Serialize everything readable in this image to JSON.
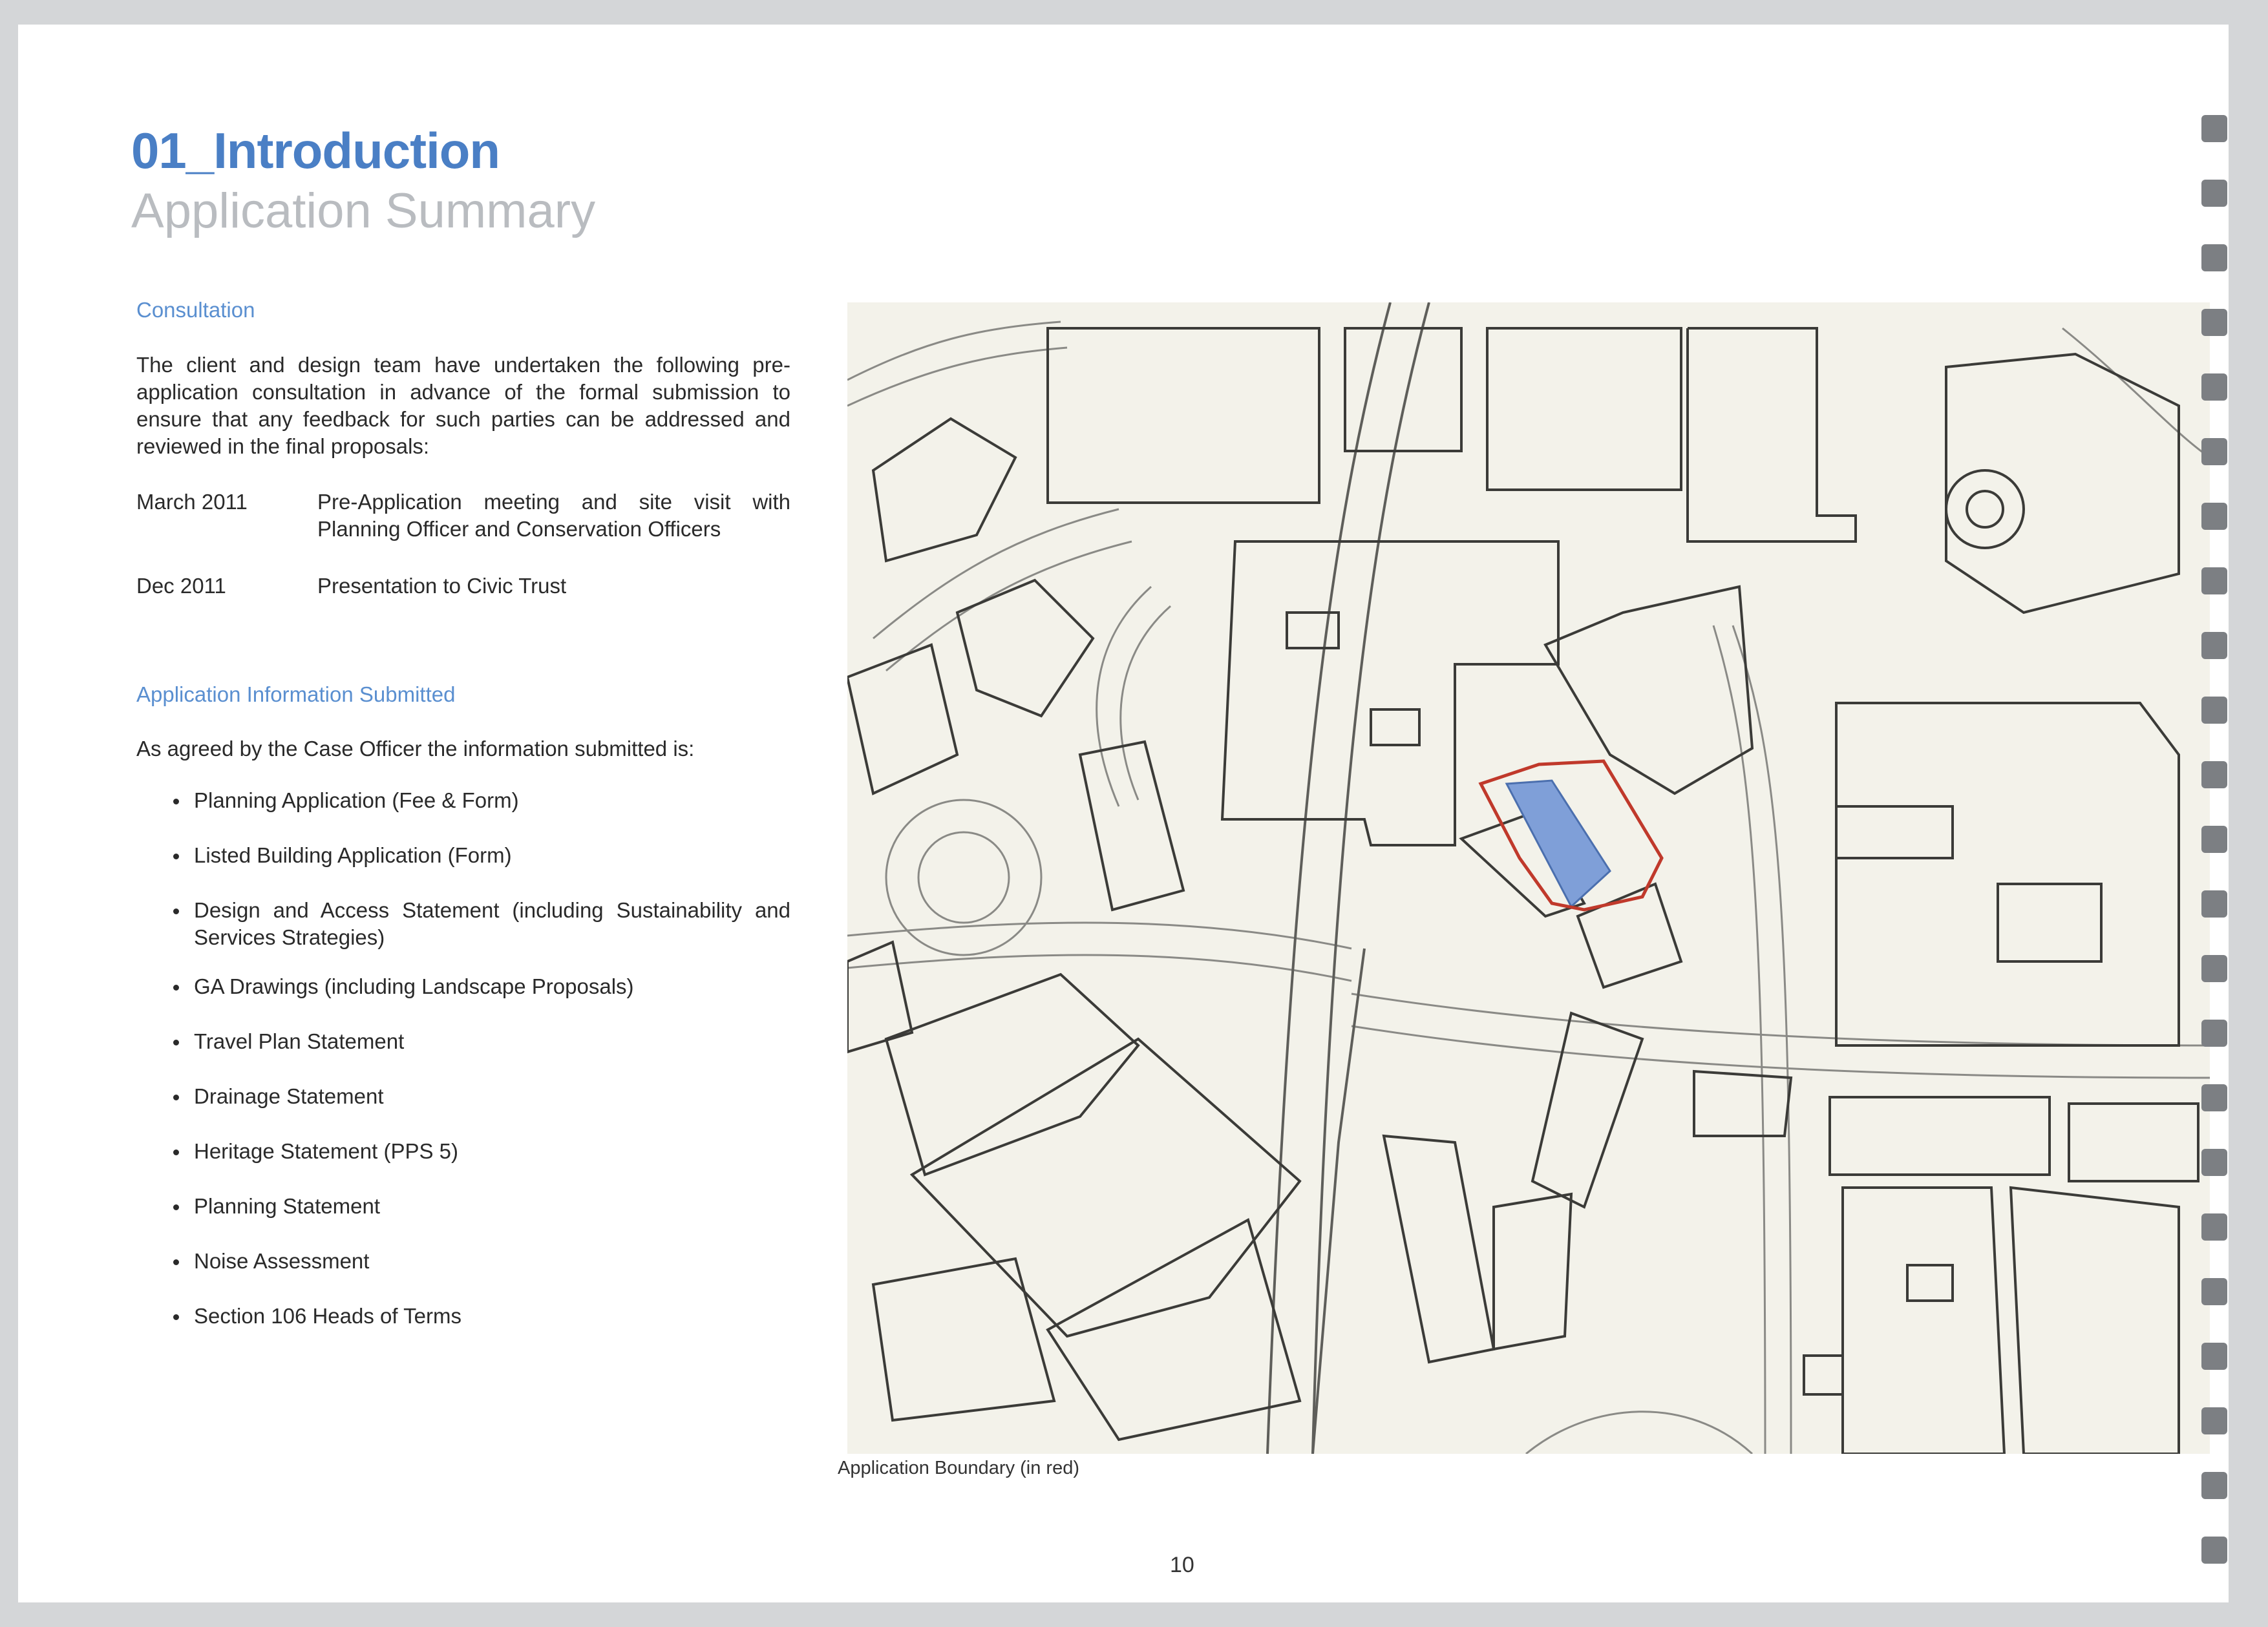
{
  "header": {
    "title": "01_Introduction",
    "subtitle": "Application Summary"
  },
  "consultation": {
    "heading": "Consultation",
    "intro": "The client and design team have undertaken the following pre-application consultation in advance of the formal submission to ensure that any feedback for such parties can be addressed and reviewed in the final proposals:",
    "entries": [
      {
        "date": "March 2011",
        "description": "Pre-Application meeting and site visit with Planning Officer and Conservation Officers"
      },
      {
        "date": "Dec 2011",
        "description": "Presentation to Civic Trust"
      }
    ]
  },
  "submission": {
    "heading": "Application Information Submitted",
    "intro": "As agreed by the Case Officer the information submitted is:",
    "items": [
      "Planning Application (Fee & Form)",
      "Listed Building Application (Form)",
      "Design and Access Statement (including Sustainability and Services Strategies)",
      "GA Drawings (including Landscape Proposals)",
      "Travel Plan Statement",
      "Drainage Statement",
      "Heritage Statement (PPS 5)",
      "Planning Statement",
      "Noise Assessment",
      "Section 106 Heads of Terms"
    ]
  },
  "map": {
    "caption": "Application Boundary (in red)",
    "boundary_color": "#c0392b",
    "site_fill_color": "#7f9fd8"
  },
  "footer": {
    "page_number": "10"
  }
}
